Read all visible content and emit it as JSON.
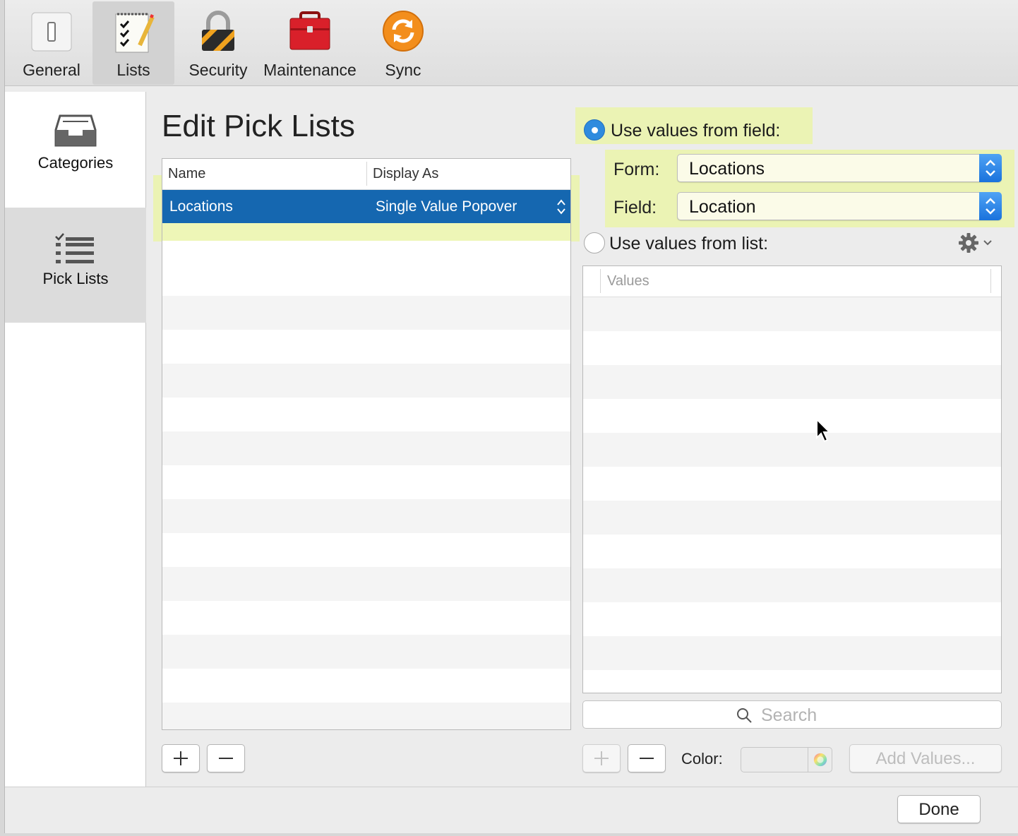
{
  "toolbar": {
    "items": [
      {
        "label": "General",
        "icon": "switch-icon"
      },
      {
        "label": "Lists",
        "icon": "notepad-checklist-icon"
      },
      {
        "label": "Security",
        "icon": "padlock-icon"
      },
      {
        "label": "Maintenance",
        "icon": "toolbox-icon"
      },
      {
        "label": "Sync",
        "icon": "sync-icon"
      }
    ],
    "active": "Lists"
  },
  "sidebar": {
    "items": [
      {
        "label": "Categories",
        "icon": "inbox-tray-icon"
      },
      {
        "label": "Pick Lists",
        "icon": "checklist-icon"
      }
    ],
    "active": "Pick Lists"
  },
  "main": {
    "title": "Edit Pick Lists",
    "pick_table": {
      "columns": [
        "Name",
        "Display As"
      ],
      "rows": [
        {
          "name": "Locations",
          "display_as": "Single Value Popover",
          "selected": true
        }
      ]
    }
  },
  "source": {
    "from_field_label": "Use values from field:",
    "from_field_selected": true,
    "form_label": "Form:",
    "form_value": "Locations",
    "field_label": "Field:",
    "field_value": "Location",
    "from_list_label": "Use values from list:",
    "values_header": "Values",
    "search_placeholder": "Search",
    "color_label": "Color:",
    "add_values_label": "Add Values..."
  },
  "footer": {
    "done_label": "Done"
  },
  "colors": {
    "selection": "#1567b0",
    "highlight": "#ebf5aa",
    "accent": "#2f8bde"
  }
}
